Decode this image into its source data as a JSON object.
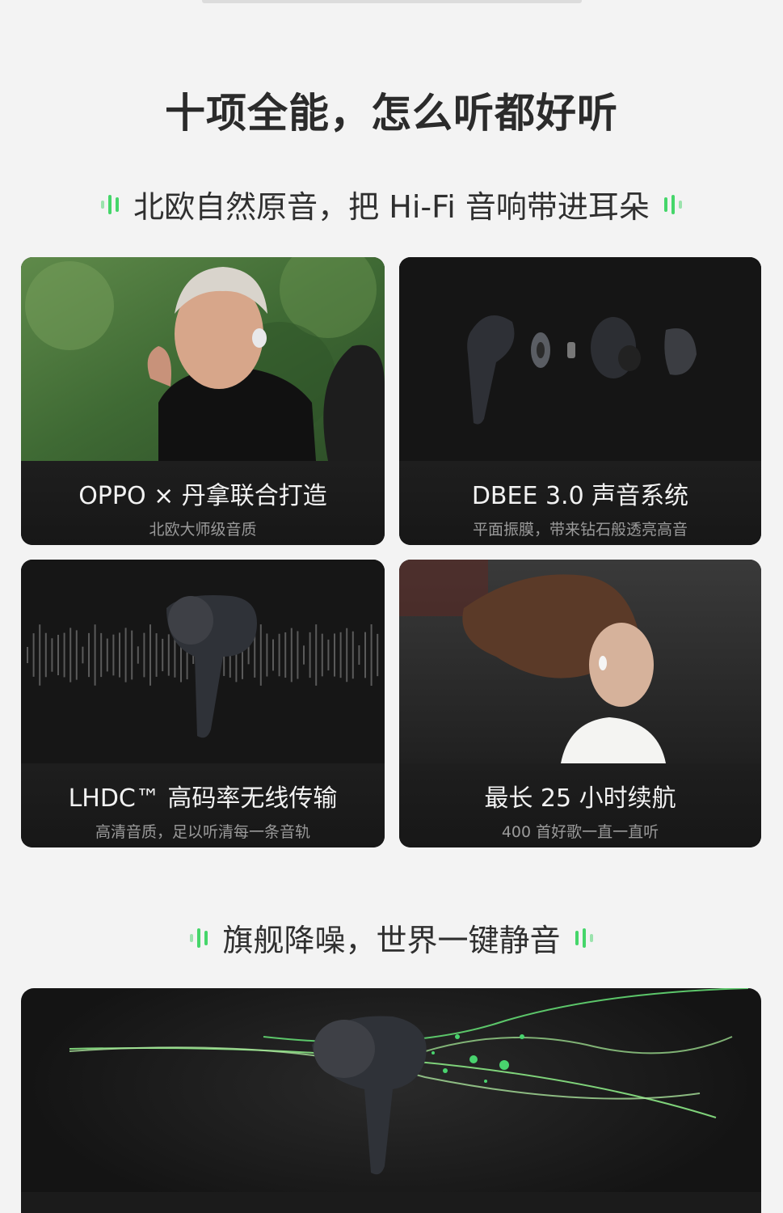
{
  "main_title": "十项全能，怎么听都好听",
  "section1": {
    "heading": "北欧自然原音，把 Hi-Fi 音响带进耳朵"
  },
  "cards": [
    {
      "title": "OPPO × 丹拿联合打造",
      "subtitle": "北欧大师级音质",
      "image": "man-wearing-earbud-photo"
    },
    {
      "title": "DBEE 3.0 声音系统",
      "subtitle": "平面振膜，带来钻石般透亮高音",
      "image": "earbud-exploded-view"
    },
    {
      "title": "LHDC™ 高码率无线传输",
      "subtitle": "高清音质，足以听清每一条音轨",
      "image": "earbud-soundwave"
    },
    {
      "title": "最长 25 小时续航",
      "subtitle": "400 首好歌一直一直听",
      "image": "woman-running-photo"
    }
  ],
  "section2": {
    "heading": "旗舰降噪，世界一键静音",
    "image": "earbud-noise-lines"
  },
  "colors": {
    "accent": "#45d66a",
    "background": "#f3f3f3",
    "card": "#121212"
  }
}
